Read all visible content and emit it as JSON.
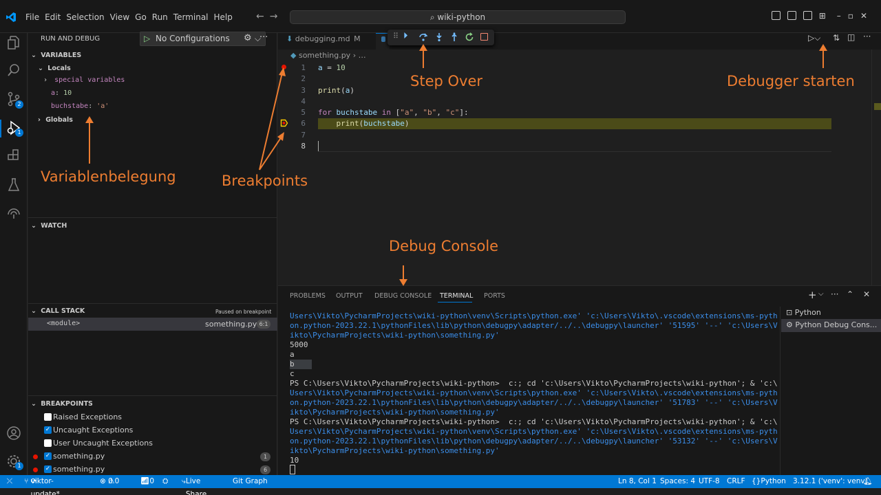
{
  "titlebar": {
    "menu": [
      "File",
      "Edit",
      "Selection",
      "View",
      "Go",
      "Run",
      "Terminal",
      "Help"
    ],
    "search": "wiki-python"
  },
  "sidebar": {
    "title": "RUN AND DEBUG",
    "config": "No Configurations",
    "variables": {
      "header": "VARIABLES",
      "locals": "Locals",
      "special": "special variables",
      "a_name": "a",
      "a_value": "10",
      "b_name": "buchstabe",
      "b_value": "'a'",
      "globals": "Globals"
    },
    "watch": "WATCH",
    "callstack": {
      "header": "CALL STACK",
      "status": "Paused on breakpoint",
      "frame": "<module>",
      "file": "something.py",
      "pos": "6:1"
    },
    "breakpoints": {
      "header": "BREAKPOINTS",
      "items": [
        {
          "label": "Raised Exceptions",
          "checked": false
        },
        {
          "label": "Uncaught Exceptions",
          "checked": true
        },
        {
          "label": "User Uncaught Exceptions",
          "checked": false
        },
        {
          "label": "something.py",
          "checked": true,
          "count": "1"
        },
        {
          "label": "something.py",
          "checked": true,
          "count": "6"
        }
      ]
    }
  },
  "editor": {
    "tab1": "debugging.md",
    "tab1_mark": "M",
    "breadcrumb_file": "something.py",
    "breadcrumb_rest": "…",
    "line_numbers": [
      "1",
      "2",
      "3",
      "4",
      "5",
      "6",
      "7",
      "8"
    ]
  },
  "panel": {
    "tabs": [
      "PROBLEMS",
      "OUTPUT",
      "DEBUG CONSOLE",
      "TERMINAL",
      "PORTS"
    ],
    "active_tab": "TERMINAL",
    "terminal_lines": [
      "Users\\Vikto\\PycharmProjects\\wiki-python\\venv\\Scripts\\python.exe' 'c:\\Users\\Vikto\\.vscode\\extensions\\ms-pyth",
      "on.python-2023.22.1\\pythonFiles\\lib\\python\\debugpy\\adapter/../..\\debugpy\\launcher' '51595' '--' 'c:\\Users\\V",
      "ikto\\PycharmProjects\\wiki-python\\something.py'",
      "5000",
      "a",
      "b",
      "c",
      "PS C:\\Users\\Vikto\\PycharmProjects\\wiki-python>  c:; cd 'c:\\Users\\Vikto\\PycharmProjects\\wiki-python'; & 'c:\\",
      "Users\\Vikto\\PycharmProjects\\wiki-python\\venv\\Scripts\\python.exe' 'c:\\Users\\Vikto\\.vscode\\extensions\\ms-pyth",
      "on.python-2023.22.1\\pythonFiles\\lib\\python\\debugpy\\adapter/../..\\debugpy\\launcher' '51783' '--' 'c:\\Users\\V",
      "ikto\\PycharmProjects\\wiki-python\\something.py'",
      "PS C:\\Users\\Vikto\\PycharmProjects\\wiki-python>  c:; cd 'c:\\Users\\Vikto\\PycharmProjects\\wiki-python'; & 'c:\\",
      "Users\\Vikto\\PycharmProjects\\wiki-python\\venv\\Scripts\\python.exe' 'c:\\Users\\Vikto\\.vscode\\extensions\\ms-pyth",
      "on.python-2023.22.1\\pythonFiles\\lib\\python\\debugpy\\adapter/../..\\debugpy\\launcher' '53132' '--' 'c:\\Users\\V",
      "ikto\\PycharmProjects\\wiki-python\\something.py'",
      "10"
    ],
    "terminals": [
      "Python",
      "Python Debug Cons..."
    ]
  },
  "status": {
    "branch": "viktor-update*",
    "errors": "0",
    "warnings": "0",
    "ports": "0",
    "liveshare": "Live Share",
    "gitgraph": "Git Graph",
    "position": "Ln 8, Col 1",
    "spaces": "Spaces: 4",
    "encoding": "UTF-8",
    "eol": "CRLF",
    "language": "Python",
    "interpreter": "3.12.1 ('venv': venv)"
  },
  "annotations": {
    "step_over": "Step Over",
    "debugger_start": "Debugger starten",
    "variables": "Variablenbelegung",
    "breakpoints": "Breakpoints",
    "debug_console": "Debug Console"
  },
  "colors": {
    "accent": "#0078d4",
    "annotation": "#ed7d31",
    "breakpoint": "#e51400"
  }
}
